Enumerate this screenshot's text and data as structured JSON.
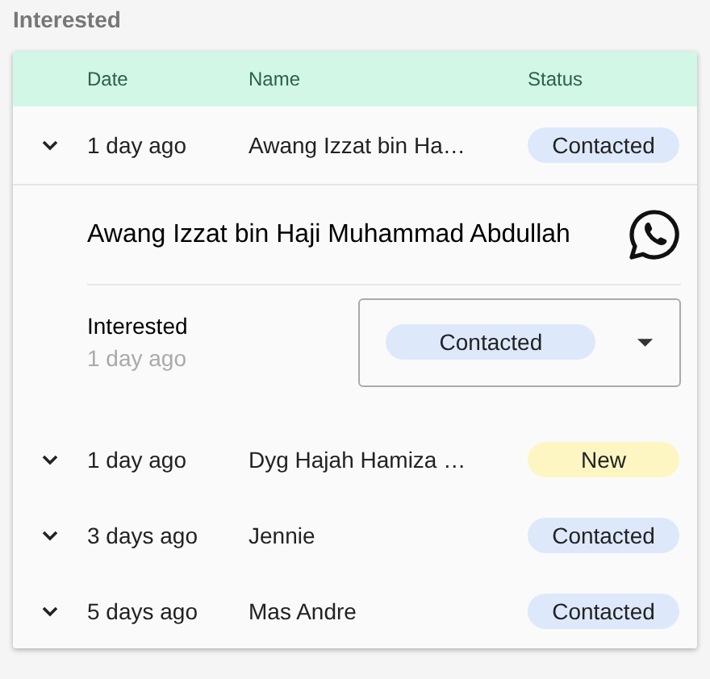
{
  "section_title": "Interested",
  "table": {
    "columns": [
      "Date",
      "Name",
      "Status"
    ],
    "rows": [
      {
        "date": "1 day ago",
        "name": "Awang Izzat bin Ha…",
        "status": "Contacted",
        "color": "#dde9fb",
        "expanded": true,
        "detail": {
          "full_name": "Awang Izzat bin Haji Muhammad Abdullah",
          "stage": "Interested",
          "stage_time": "1 day ago",
          "status_select": {
            "value": "Contacted",
            "color": "#dde9fb"
          }
        }
      },
      {
        "date": "1 day ago",
        "name": "Dyg Hajah Hamiza …",
        "status": "New",
        "color": "#fdf6c3",
        "expanded": false
      },
      {
        "date": "3 days ago",
        "name": "Jennie",
        "status": "Contacted",
        "color": "#dde9fb",
        "expanded": false
      },
      {
        "date": "5 days ago",
        "name": "Mas Andre",
        "status": "Contacted",
        "color": "#dde9fb",
        "expanded": false
      }
    ]
  }
}
